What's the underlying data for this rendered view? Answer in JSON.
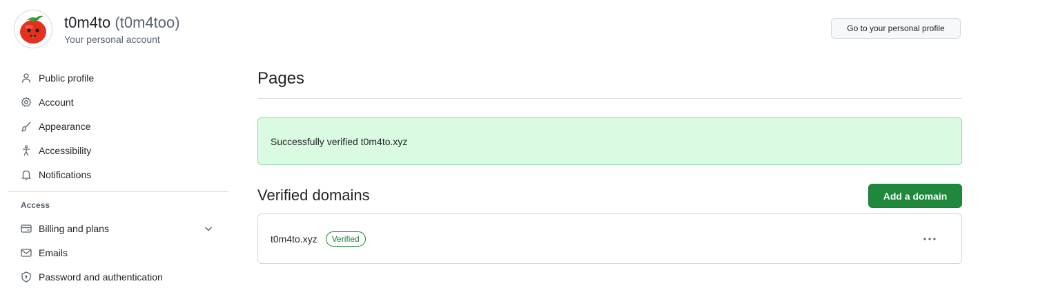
{
  "header": {
    "name": "t0m4to",
    "login": "(t0m4too)",
    "subtitle": "Your personal account",
    "profile_button": "Go to your personal profile"
  },
  "sidebar": {
    "items": [
      {
        "label": "Public profile",
        "icon": "person-icon"
      },
      {
        "label": "Account",
        "icon": "gear-icon"
      },
      {
        "label": "Appearance",
        "icon": "paintbrush-icon"
      },
      {
        "label": "Accessibility",
        "icon": "accessibility-icon"
      },
      {
        "label": "Notifications",
        "icon": "bell-icon"
      }
    ],
    "access_heading": "Access",
    "access_items": [
      {
        "label": "Billing and plans",
        "icon": "credit-card-icon"
      },
      {
        "label": "Emails",
        "icon": "mail-icon"
      },
      {
        "label": "Password and authentication",
        "icon": "shield-lock-icon"
      }
    ]
  },
  "main": {
    "title": "Pages",
    "flash_message": "Successfully verified t0m4to.xyz",
    "verified_domains_title": "Verified domains",
    "add_domain_button": "Add a domain",
    "domains": [
      {
        "name": "t0m4to.xyz",
        "status": "Verified"
      }
    ]
  },
  "colors": {
    "accent_green": "#1f883d",
    "flash_bg": "#dafbe1",
    "badge_green": "#1a7f37"
  }
}
